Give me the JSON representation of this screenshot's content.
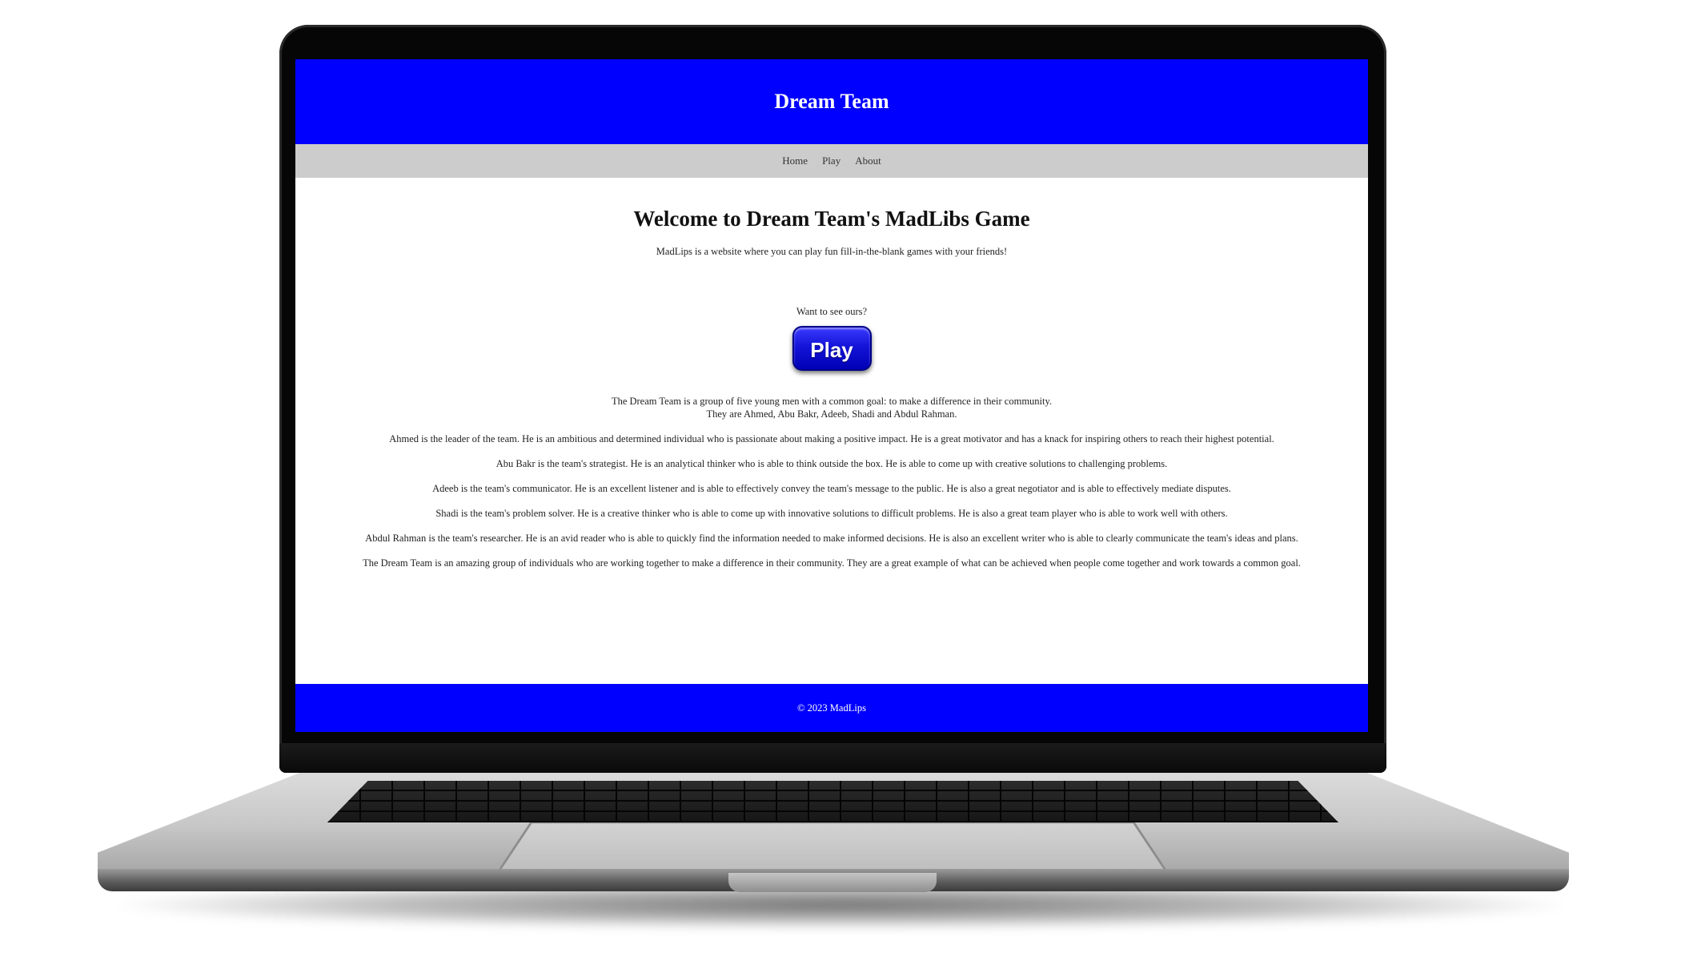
{
  "site": {
    "header_title": "Dream Team",
    "nav": [
      "Home",
      "Play",
      "About"
    ],
    "welcome_heading": "Welcome to Dream Team's MadLibs Game",
    "intro": "MadLips is a website where you can play fun fill-in-the-blank games with your friends!",
    "want_prompt": "Want to see ours?",
    "play_button": "Play",
    "team_summary_line1": "The Dream Team is a group of five young men with a common goal: to make a difference in their community.",
    "team_summary_line2": "They are Ahmed, Abu Bakr, Adeeb, Shadi and Abdul Rahman.",
    "bios": [
      "Ahmed is the leader of the team. He is an ambitious and determined individual who is passionate about making a positive impact. He is a great motivator and has a knack for inspiring others to reach their highest potential.",
      "Abu Bakr is the team's strategist. He is an analytical thinker who is able to think outside the box. He is able to come up with creative solutions to challenging problems.",
      "Adeeb is the team's communicator. He is an excellent listener and is able to effectively convey the team's message to the public. He is also a great negotiator and is able to effectively mediate disputes.",
      "Shadi is the team's problem solver. He is a creative thinker who is able to come up with innovative solutions to difficult problems. He is also a great team player who is able to work well with others.",
      "Abdul Rahman is the team's researcher. He is an avid reader who is able to quickly find the information needed to make informed decisions. He is also an excellent writer who is able to clearly communicate the team's ideas and plans.",
      "The Dream Team is an amazing group of individuals who are working together to make a difference in their community. They are a great example of what can be achieved when people come together and work towards a common goal."
    ],
    "footer": "© 2023 MadLips"
  },
  "colors": {
    "header_bg": "#0000ff",
    "nav_bg": "#cccccc",
    "footer_bg": "#0000ff",
    "play_button": "#1414d8"
  }
}
